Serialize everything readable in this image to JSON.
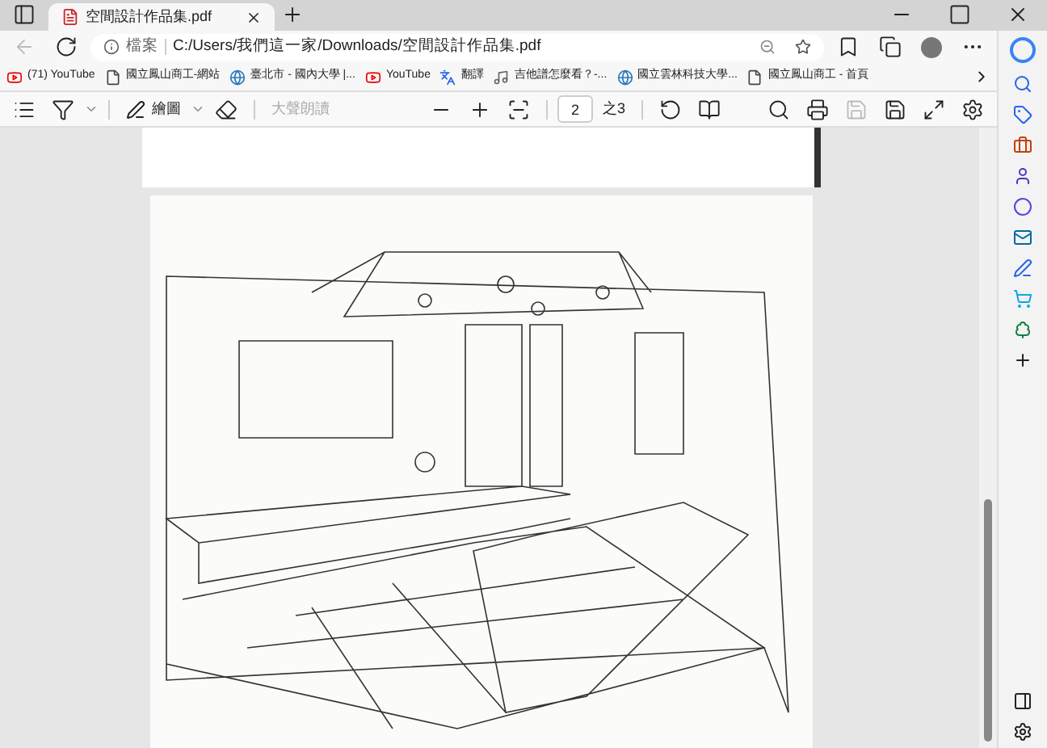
{
  "tab": {
    "title": "空間設計作品集.pdf",
    "selected": true
  },
  "address": {
    "label": "檔案",
    "url": "C:/Users/我們這一家/Downloads/空間設計作品集.pdf"
  },
  "bookmarks": [
    {
      "kind": "youtube",
      "label": "(71) YouTube"
    },
    {
      "kind": "page",
      "label": "國立鳳山商工-網站"
    },
    {
      "kind": "globe",
      "label": "臺北市 - 國內大學 |..."
    },
    {
      "kind": "youtube",
      "label": "YouTube"
    },
    {
      "kind": "translate",
      "label": "翻譯"
    },
    {
      "kind": "music",
      "label": "吉他譜怎麼看？-..."
    },
    {
      "kind": "globe",
      "label": "國立雲林科技大學..."
    },
    {
      "kind": "page",
      "label": "國立鳳山商工 - 首頁"
    }
  ],
  "pdf_toolbar": {
    "draw_label": "繪圖",
    "read_aloud": {
      "label": "大聲朗讀",
      "disabled": true
    },
    "page": "2",
    "page_total": "之3"
  }
}
